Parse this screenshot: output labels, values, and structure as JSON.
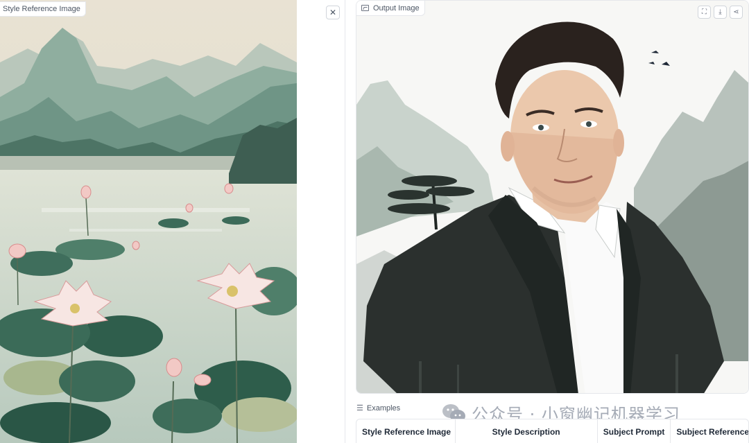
{
  "style_reference": {
    "label": "Style Reference Image",
    "image_icon": "image-icon",
    "close_icon": "close-icon"
  },
  "output": {
    "label": "Output Image",
    "image_icon": "image-icon",
    "toolbar": [
      {
        "name": "fullscreen-icon",
        "glyph": "⛶"
      },
      {
        "name": "download-icon",
        "glyph": "⤓"
      },
      {
        "name": "share-icon",
        "glyph": "⤤"
      }
    ]
  },
  "examples": {
    "label": "Examples",
    "columns": [
      "Style Reference Image",
      "Style Description",
      "Subject Prompt",
      "Subject Reference"
    ]
  },
  "watermark": {
    "text": "公众号 · 小窗幽记机器学习"
  },
  "colors": {
    "border": "#e5e7eb",
    "text": "#1f2937",
    "muted": "#4b5563"
  }
}
